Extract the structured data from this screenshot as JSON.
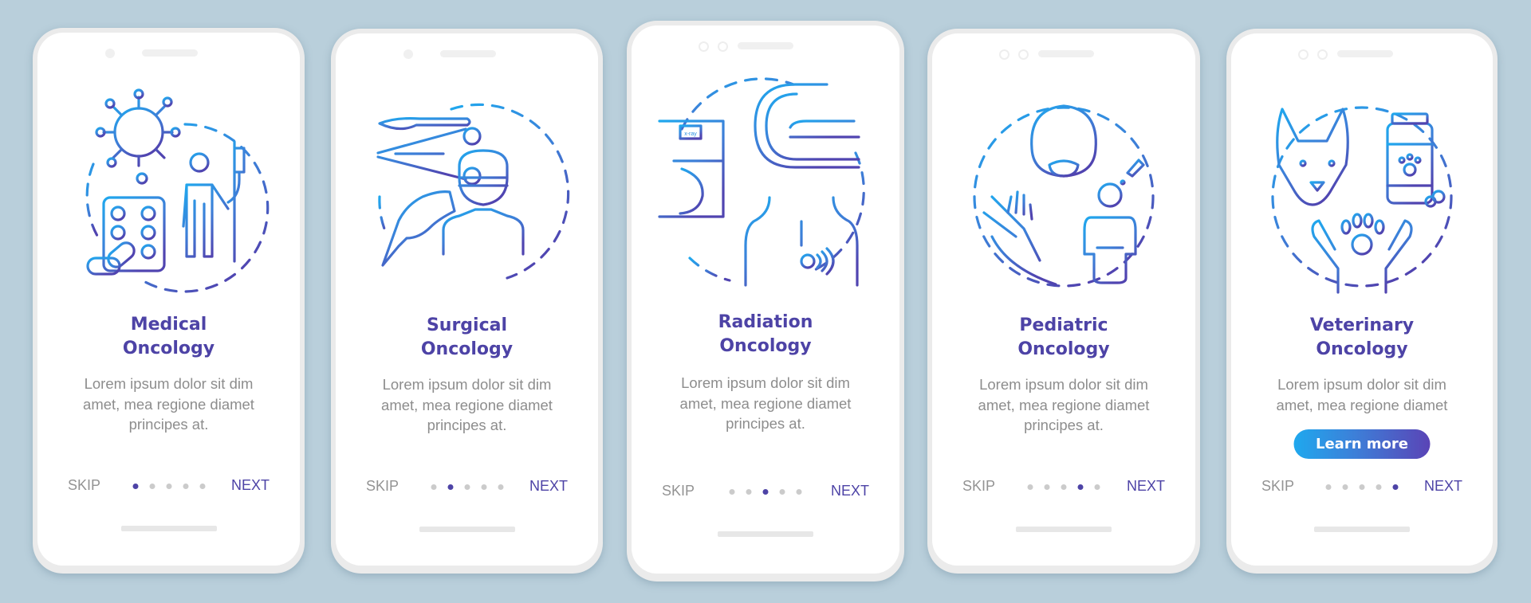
{
  "colors": {
    "background": "#b9cfdb",
    "accent_purple": "#4d43a6",
    "accent_blue": "#1fa8ee",
    "body_gray": "#8d8d8d",
    "dot_inactive": "#cbcbcb"
  },
  "screens": [
    {
      "title_line1": "Medical",
      "title_line2": "Oncology",
      "body_line1": "Lorem ipsum dolor sit dim",
      "body_line2": "amet, mea regione diamet",
      "body_line3": "principes at.",
      "skip": "SKIP",
      "next": "NEXT",
      "active_dot": 1,
      "illustration": "virus-pills-iv-drip-patient-icon"
    },
    {
      "title_line1": "Surgical",
      "title_line2": "Oncology",
      "body_line1": "Lorem ipsum dolor sit dim",
      "body_line2": "amet, mea regione diamet",
      "body_line3": "principes at.",
      "skip": "SKIP",
      "next": "NEXT",
      "active_dot": 2,
      "illustration": "scalpel-forceps-surgeon-icon"
    },
    {
      "title_line1": "Radiation",
      "title_line2": "Oncology",
      "body_line1": "Lorem ipsum dolor sit dim",
      "body_line2": "amet, mea regione diamet",
      "body_line3": "principes at.",
      "skip": "SKIP",
      "next": "NEXT",
      "active_dot": 3,
      "illustration": "mammography-ct-scanner-torso-icon",
      "xray_label": "x-ray"
    },
    {
      "title_line1": "Pediatric",
      "title_line2": "Oncology",
      "body_line1": "Lorem ipsum dolor sit dim",
      "body_line2": "amet, mea regione diamet",
      "body_line3": "principes at.",
      "skip": "SKIP",
      "next": "NEXT",
      "active_dot": 4,
      "illustration": "baby-hands-child-dropper-icon"
    },
    {
      "title_line1": "Veterinary",
      "title_line2": "Oncology",
      "body_line1": "Lorem ipsum dolor sit dim",
      "body_line2": "amet, mea regione diamet",
      "button": "Learn more",
      "skip": "SKIP",
      "next": "NEXT",
      "active_dot": 5,
      "illustration": "dog-pill-bottle-paw-hands-icon"
    }
  ]
}
